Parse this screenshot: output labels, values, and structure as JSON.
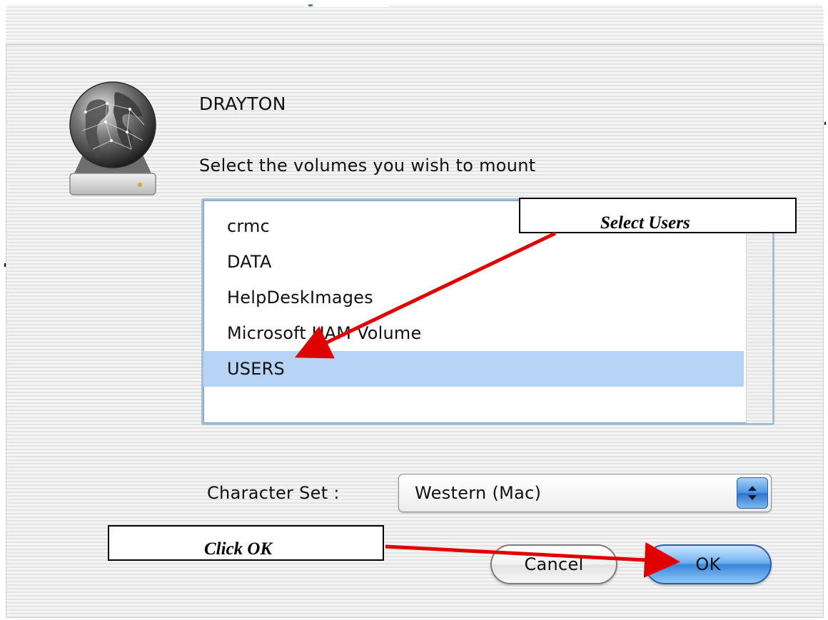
{
  "dialog": {
    "server_name": "DRAYTON",
    "prompt": "Select the volumes you wish to mount"
  },
  "volumes": {
    "items": [
      "crmc",
      "DATA",
      "HelpDeskImages",
      "Microsoft UAM Volume",
      "USERS"
    ],
    "selected_index": 4
  },
  "character_set": {
    "label": "Character Set :",
    "value": "Western (Mac)"
  },
  "buttons": {
    "cancel": "Cancel",
    "ok": "OK"
  },
  "annotations": {
    "select_users": "Select Users",
    "click_ok": "Click OK",
    "arrow_color": "#e00000"
  },
  "icons": {
    "server": "globe-server-icon",
    "select_arrows": "chevron-updown-icon"
  },
  "colors": {
    "selection": "#b7d3f5",
    "ok_button": "#3a86db"
  }
}
